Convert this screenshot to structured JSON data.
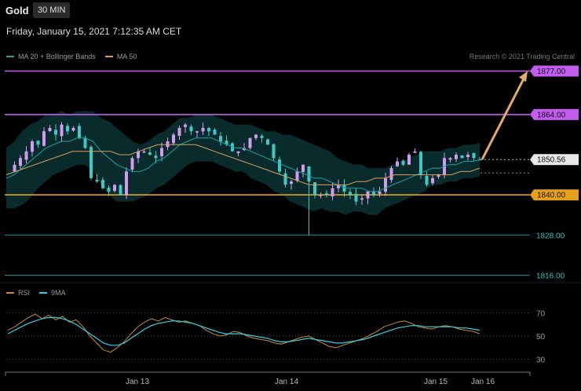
{
  "header": {
    "symbol": "Gold",
    "timeframe": "30 MIN",
    "datetime": "Friday, January 15, 2021 7:12:35 AM CET",
    "copyright": "Research © 2021 Trading Central"
  },
  "legend_main": [
    {
      "label": "MA 20 + Bollinger Bands",
      "color": "#17a6a6"
    },
    {
      "label": "MA 50",
      "color": "#d9a060"
    }
  ],
  "legend_rsi": [
    {
      "label": "RSI",
      "color": "#c98a3a"
    },
    {
      "label": "9MA",
      "color": "#2fd3e0"
    }
  ],
  "colors": {
    "resistance": "#c45cf0",
    "support_orange": "#e6a019",
    "support_teal": "#138e8e",
    "up_candle": "#d39bf0",
    "down_candle": "#3ec9c9",
    "arrow": "#e0aa70",
    "current_price_bg": "#e8e8e8"
  },
  "chart_data": [
    {
      "type": "candlestick",
      "title": "Gold 30 MIN",
      "y_range": [
        1810,
        1884
      ],
      "x_ticks": [
        "Jan 13",
        "Jan 14",
        "Jan 15",
        "Jan 16"
      ],
      "levels": [
        {
          "value": 1877.0,
          "label": "1877.00",
          "role": "target",
          "color": "#c45cf0"
        },
        {
          "value": 1864.0,
          "label": "1864.00",
          "role": "resistance",
          "color": "#c45cf0"
        },
        {
          "value": 1850.56,
          "label": "1850.56",
          "role": "last price",
          "color": "#e8e8e8"
        },
        {
          "value": 1840.0,
          "label": "1840.00",
          "role": "pivot",
          "color": "#e6a019"
        },
        {
          "value": 1828.0,
          "label": "1828.00",
          "role": "support",
          "color": "#138e8e"
        },
        {
          "value": 1816.0,
          "label": "1816.00",
          "role": "support",
          "color": "#138e8e"
        }
      ],
      "close_path": [
        1847,
        1849,
        1851,
        1853,
        1856,
        1855,
        1859,
        1860,
        1858,
        1861,
        1859,
        1860,
        1857,
        1854,
        1845,
        1844,
        1842,
        1841,
        1843,
        1840,
        1847,
        1851,
        1853,
        1853,
        1852,
        1851,
        1854,
        1856,
        1858,
        1860,
        1861,
        1859,
        1859,
        1860,
        1859,
        1858,
        1856,
        1855,
        1853,
        1853,
        1854,
        1857,
        1858,
        1857,
        1855,
        1851,
        1847,
        1843,
        1844,
        1847,
        1849,
        1844,
        1840,
        1840,
        1840,
        1842,
        1843,
        1841,
        1840,
        1838,
        1839,
        1841,
        1840,
        1841,
        1845,
        1848,
        1850,
        1849,
        1852,
        1853,
        1846,
        1843,
        1845,
        1846,
        1851,
        1851,
        1852,
        1851,
        1852,
        1851,
        1850.56
      ],
      "wick_extremes": {
        "high": 1862,
        "low": 1828
      },
      "ma20": [
        1845,
        1846,
        1848,
        1850,
        1852,
        1854,
        1855,
        1856,
        1856,
        1857,
        1857,
        1856,
        1853,
        1851,
        1849,
        1848,
        1847,
        1847,
        1848,
        1850,
        1851,
        1853,
        1855,
        1856,
        1857,
        1857,
        1857,
        1856,
        1855,
        1854,
        1854,
        1853,
        1852,
        1851,
        1850,
        1849,
        1848,
        1847,
        1846,
        1845,
        1845,
        1844,
        1843,
        1842,
        1842,
        1842,
        1841,
        1841,
        1842,
        1843,
        1844,
        1845,
        1846,
        1847,
        1848,
        1848,
        1849,
        1849,
        1850,
        1850,
        1850.5
      ],
      "ma50": [
        1846,
        1847,
        1848,
        1849,
        1850,
        1851,
        1852,
        1853,
        1853,
        1853,
        1853,
        1853,
        1852,
        1852,
        1853,
        1854,
        1855,
        1855,
        1855,
        1855,
        1855,
        1854,
        1853,
        1852,
        1851,
        1850,
        1849,
        1848,
        1847,
        1846,
        1845,
        1844,
        1843,
        1843,
        1843,
        1843,
        1843,
        1844,
        1844,
        1845,
        1845,
        1846,
        1846,
        1846,
        1846,
        1846,
        1846,
        1846,
        1847,
        1847,
        1848
      ],
      "projection": {
        "from": 1850.56,
        "to": 1877.0
      }
    },
    {
      "type": "line",
      "title": "RSI",
      "y_ticks": [
        70,
        50,
        30
      ],
      "y_range": [
        22,
        80
      ],
      "series": [
        {
          "name": "RSI",
          "values": [
            55,
            58,
            62,
            66,
            69,
            65,
            68,
            64,
            67,
            62,
            64,
            58,
            50,
            44,
            38,
            36,
            40,
            45,
            52,
            58,
            62,
            65,
            63,
            66,
            64,
            62,
            63,
            61,
            59,
            55,
            52,
            50,
            51,
            54,
            53,
            50,
            48,
            47,
            46,
            44,
            43,
            45,
            47,
            49,
            50,
            47,
            44,
            41,
            40,
            42,
            44,
            46,
            48,
            51,
            54,
            58,
            60,
            62,
            63,
            61,
            58,
            57,
            56,
            58,
            59,
            58,
            56,
            55,
            54,
            52
          ]
        },
        {
          "name": "9MA",
          "values": [
            52,
            55,
            58,
            61,
            63,
            65,
            66,
            66,
            65,
            63,
            60,
            56,
            52,
            48,
            44,
            42,
            42,
            44,
            48,
            52,
            56,
            59,
            61,
            62,
            63,
            63,
            62,
            61,
            59,
            57,
            55,
            53,
            52,
            52,
            52,
            51,
            50,
            49,
            48,
            46,
            45,
            45,
            46,
            47,
            48,
            47,
            46,
            45,
            44,
            44,
            45,
            46,
            47,
            49,
            51,
            53,
            55,
            57,
            58,
            59,
            59,
            58,
            58,
            58,
            58,
            58,
            57,
            57,
            56,
            55
          ]
        }
      ]
    }
  ]
}
